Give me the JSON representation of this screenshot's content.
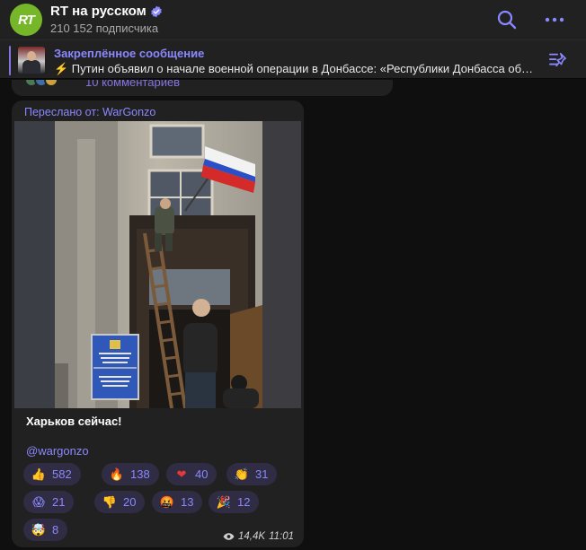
{
  "header": {
    "channel_title": "RT на русском",
    "subscribers": "210 152 подписчика",
    "avatar_text": "RT"
  },
  "pinned": {
    "title": "Закреплённое сообщение",
    "text": "⚡️ Путин объявил о начале военной операции в Донбассе:  «Республики Донбасса обратились к России за помощью"
  },
  "prev_message": {
    "comments_label": "10 комментариев"
  },
  "message": {
    "forwarded_from": "Переслано от: WarGonzo",
    "caption": "Харьков сейчас!",
    "mention": "@wargonzo",
    "views": "14,4K",
    "time": "11:01",
    "reactions": [
      {
        "emoji": "👍",
        "count": "582"
      },
      {
        "emoji": "🔥",
        "count": "138"
      },
      {
        "emoji": "❤",
        "count": "40"
      },
      {
        "emoji": "👏",
        "count": "31"
      },
      {
        "emoji": "😱",
        "count": "21"
      },
      {
        "emoji": "👎",
        "count": "20"
      },
      {
        "emoji": "🤬",
        "count": "13"
      },
      {
        "emoji": "🎉",
        "count": "12"
      },
      {
        "emoji": "🤯",
        "count": "8"
      }
    ]
  },
  "colors": {
    "accent": "#8b88ff",
    "brand": "#76b72a",
    "panel": "#212121",
    "background": "#0f0f0f"
  }
}
